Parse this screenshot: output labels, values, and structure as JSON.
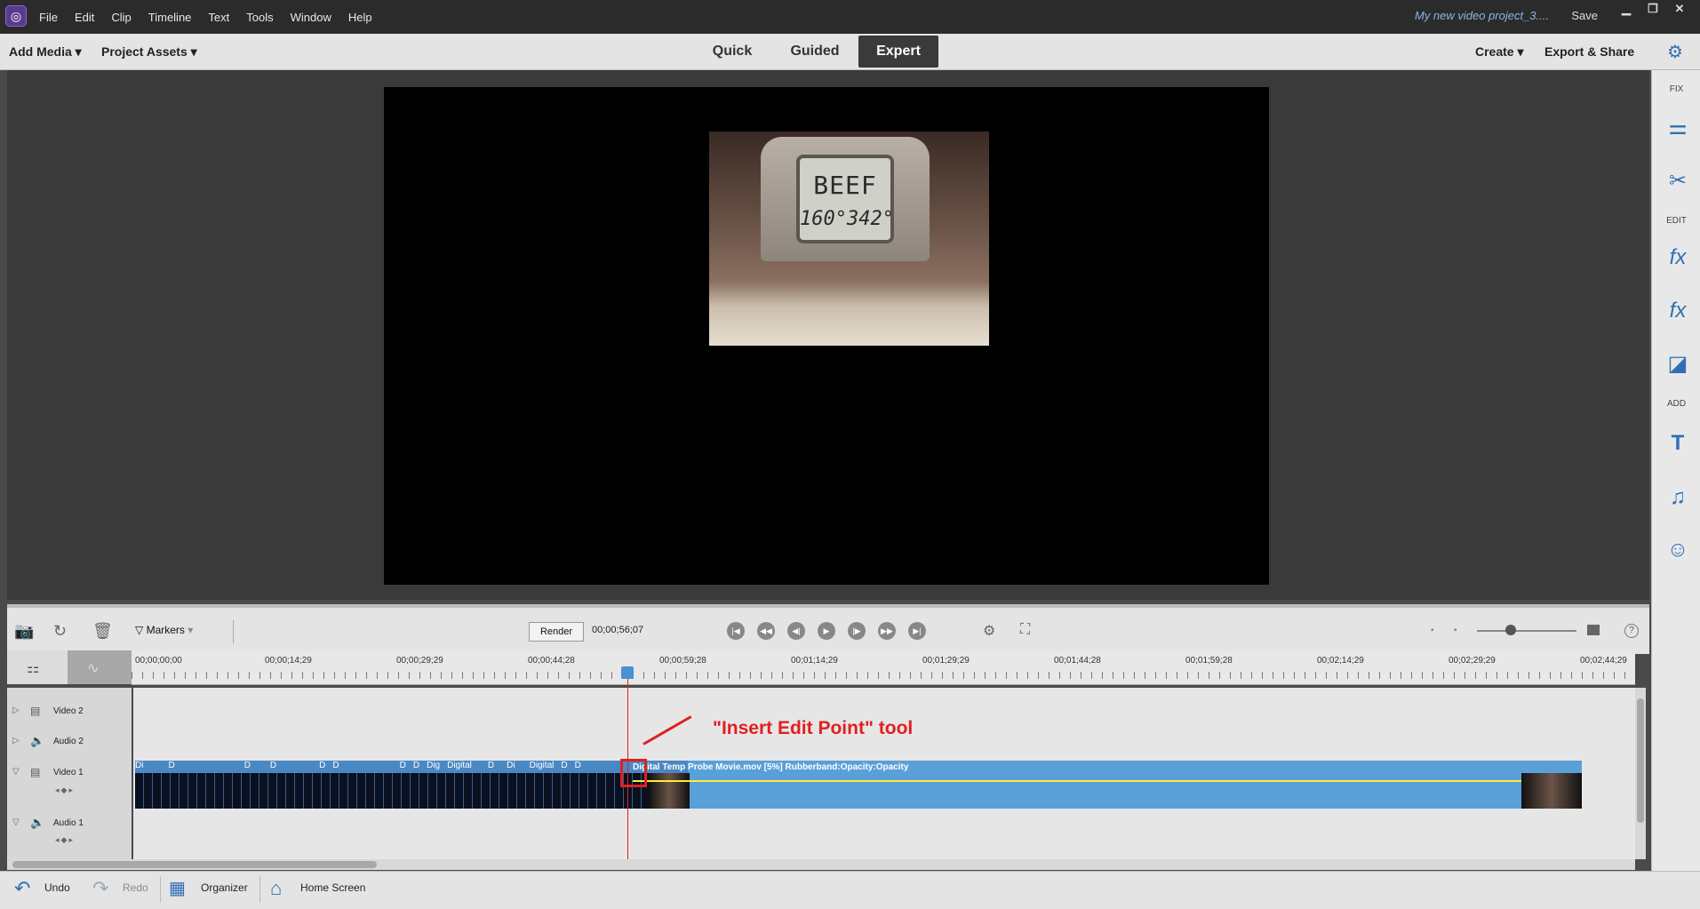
{
  "window": {
    "project_name": "My new video project_3....",
    "save_label": "Save",
    "minimize": "▁",
    "restore": "❐",
    "close": "✕"
  },
  "menu": [
    "File",
    "Edit",
    "Clip",
    "Timeline",
    "Text",
    "Tools",
    "Window",
    "Help"
  ],
  "modebar": {
    "add_media": "Add Media",
    "project_assets": "Project Assets",
    "tabs": [
      "Quick",
      "Guided",
      "Expert"
    ],
    "active_tab": "Expert",
    "create": "Create",
    "export_share": "Export & Share"
  },
  "right_panel": {
    "fix_label": "FIX",
    "edit_label": "EDIT",
    "add_label": "ADD",
    "fx_label": "fx",
    "text_icon_label": "T"
  },
  "preview": {
    "lcd_top": "BEEF",
    "lcd_bottom": "160°342°"
  },
  "timeline_toolbar": {
    "markers_label": "Markers",
    "render_label": "Render",
    "timecode": "00;00;56;07"
  },
  "ruler": {
    "ticks": [
      "00;00;00;00",
      "00;00;14;29",
      "00;00;29;29",
      "00;00;44;28",
      "00;00;59;28",
      "00;01;14;29",
      "00;01;29;29",
      "00;01;44;28",
      "00;01;59;28",
      "00;02;14;29",
      "00;02;29;29",
      "00;02;44;29"
    ]
  },
  "tracks": [
    "Video 2",
    "Audio 2",
    "Video 1",
    "Audio 1"
  ],
  "clip": {
    "labels": [
      "Di",
      "D",
      "D",
      "D",
      "D",
      "D",
      "D",
      "D",
      "Dig",
      "Digital",
      "D",
      "Di",
      "Digital",
      "D",
      "D"
    ],
    "name": "Digital Temp Probe Movie.mov [5%] Rubberband:Opacity:Opacity"
  },
  "annotation": "\"Insert Edit Point\" tool",
  "bottom_bar": {
    "undo": "Undo",
    "redo": "Redo",
    "organizer": "Organizer",
    "home_screen": "Home Screen"
  },
  "colors": {
    "accent": "#2f6fb5",
    "clip_blue": "#5aa0d8",
    "playhead_red": "#e02020",
    "rubberband": "#ffeb3b",
    "title_bar": "#2b2b2b"
  }
}
